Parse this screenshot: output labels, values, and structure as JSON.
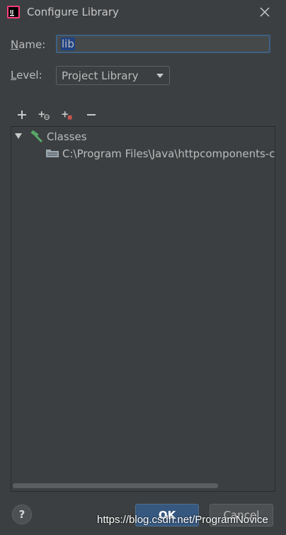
{
  "window": {
    "title": "Configure Library",
    "app_icon_text": "IJ"
  },
  "form": {
    "name_label_prefix": "N",
    "name_label_rest": "ame:",
    "name_value": "lib",
    "level_label_prefix": "L",
    "level_label_rest": "evel:",
    "level_value": "Project Library"
  },
  "tree": {
    "root_label": "Classes",
    "child_path": "C:\\Program Files\\Java\\httpcomponents-cl"
  },
  "buttons": {
    "help": "?",
    "ok": "OK",
    "cancel": "Cancel"
  },
  "watermark": "https://blog.csdn.net/ProgramNovice",
  "colors": {
    "background": "#3c3f41",
    "accent_blue": "#365880",
    "icon_green": "#59a869",
    "icon_red": "#c75450"
  }
}
